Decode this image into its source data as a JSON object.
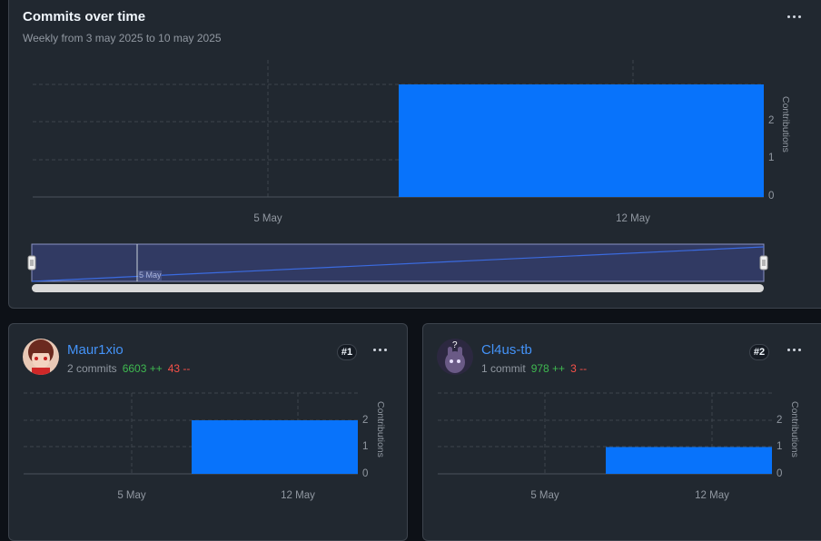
{
  "header": {
    "title": "Commits over time",
    "subtitle": "Weekly from 3 may 2025 to 10 may 2025"
  },
  "main_chart": {
    "y_axis_label": "Contributions",
    "y_ticks": [
      "0",
      "1",
      "2"
    ],
    "x_ticks": [
      "5 May",
      "12 May"
    ],
    "range_label": "5 May"
  },
  "contributors": [
    {
      "name": "Maur1xio",
      "commits": "2 commits",
      "additions": "6603 ++",
      "deletions": "43 --",
      "rank": "#1",
      "y_axis_label": "Contributions",
      "y_ticks": [
        "0",
        "1",
        "2"
      ],
      "x_ticks": [
        "5 May",
        "12 May"
      ]
    },
    {
      "name": "Cl4us-tb",
      "commits": "1 commit",
      "additions": "978 ++",
      "deletions": "3 --",
      "rank": "#2",
      "y_axis_label": "Contributions",
      "y_ticks": [
        "0",
        "1",
        "2"
      ],
      "x_ticks": [
        "5 May",
        "12 May"
      ]
    }
  ],
  "colors": {
    "bar": "#0873fb",
    "accent_link": "#4493f8",
    "additions": "#3fb950",
    "deletions": "#f85149"
  },
  "chart_data": [
    {
      "type": "bar",
      "categories": [
        "5 May",
        "12 May"
      ],
      "values": [
        0,
        3
      ],
      "ylabel": "Contributions",
      "ylim": [
        0,
        3
      ],
      "grid": true
    },
    {
      "type": "bar",
      "categories": [
        "5 May",
        "12 May"
      ],
      "series": [
        {
          "name": "Maur1xio",
          "values": [
            0,
            2
          ]
        }
      ],
      "ylabel": "Contributions",
      "ylim": [
        0,
        2
      ],
      "grid": true
    },
    {
      "type": "bar",
      "categories": [
        "5 May",
        "12 May"
      ],
      "series": [
        {
          "name": "Cl4us-tb",
          "values": [
            0,
            1
          ]
        }
      ],
      "ylabel": "Contributions",
      "ylim": [
        0,
        2
      ],
      "grid": true
    }
  ]
}
